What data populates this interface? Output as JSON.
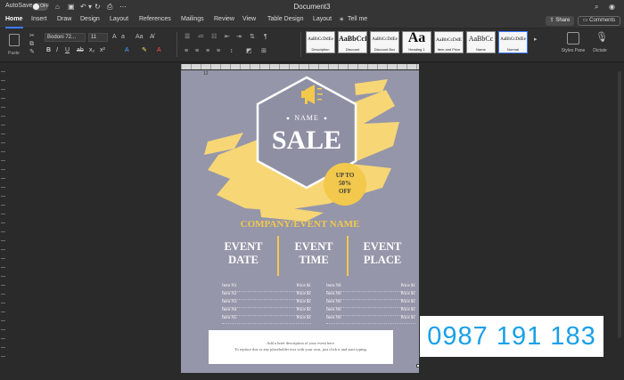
{
  "titlebar": {
    "autosave_label": "AutoSave",
    "autosave_state": "OFF",
    "document_title": "Document3"
  },
  "tabs": [
    "Home",
    "Insert",
    "Draw",
    "Design",
    "Layout",
    "References",
    "Mailings",
    "Review",
    "View",
    "Table Design",
    "Layout",
    "Tell me"
  ],
  "tell_me_icon": "lightbulb-icon",
  "share_label": "Share",
  "comments_label": "Comments",
  "ribbon": {
    "paste_label": "Paste",
    "font_name": "Bodoni 72...",
    "font_size": "11",
    "styles": [
      {
        "sample": "AaBbCcDdEe",
        "name": "Description"
      },
      {
        "sample": "AaBbCcI",
        "name": "Discount"
      },
      {
        "sample": "AaBbCcDdEe",
        "name": "Discount Box"
      },
      {
        "sample": "Aa",
        "name": "Heading 1"
      },
      {
        "sample": "AaBbCcDdE",
        "name": "Item and Price"
      },
      {
        "sample": "AaBbCc",
        "name": "Name"
      },
      {
        "sample": "AaBbCcDdEe",
        "name": "Normal"
      }
    ],
    "styles_pane_label": "Styles Pane",
    "dictate_label": "Dictate"
  },
  "poster": {
    "page_marker": "12",
    "name_label": "NAME",
    "sale_label": "SALE",
    "discount_lines": [
      "UP TO",
      "50%",
      "OFF"
    ],
    "company": "COMPANY/EVENT NAME",
    "events": [
      {
        "line1": "EVENT",
        "line2": "DATE"
      },
      {
        "line1": "EVENT",
        "line2": "TIME"
      },
      {
        "line1": "EVENT",
        "line2": "PLACE"
      }
    ],
    "items_left": [
      {
        "name": "Item N1",
        "price": "Price $1"
      },
      {
        "name": "Item N2",
        "price": "Price $1"
      },
      {
        "name": "Item N3",
        "price": "Price $1"
      },
      {
        "name": "Item N4",
        "price": "Price $1"
      },
      {
        "name": "Item N5",
        "price": "Price $1"
      }
    ],
    "items_right": [
      {
        "name": "Item N6",
        "price": "Price $1"
      },
      {
        "name": "Item N6",
        "price": "Price $1"
      },
      {
        "name": "Item N6",
        "price": "Price $1"
      },
      {
        "name": "Item N6",
        "price": "Price $1"
      },
      {
        "name": "Item N6",
        "price": "Price $1"
      }
    ],
    "description_line1": "Add a brief description of your event here.",
    "description_line2": "To replace this or any placeholder text with your own, just click it and start typing."
  },
  "overlay_phone": "0987 191 183",
  "colors": {
    "page_bg": "#9596a9",
    "accent_yellow": "#f2c94c",
    "hexagon": "#8e8fa3",
    "overlay_text": "#1aa0e8",
    "active_tab_underline": "#3d7bff"
  }
}
